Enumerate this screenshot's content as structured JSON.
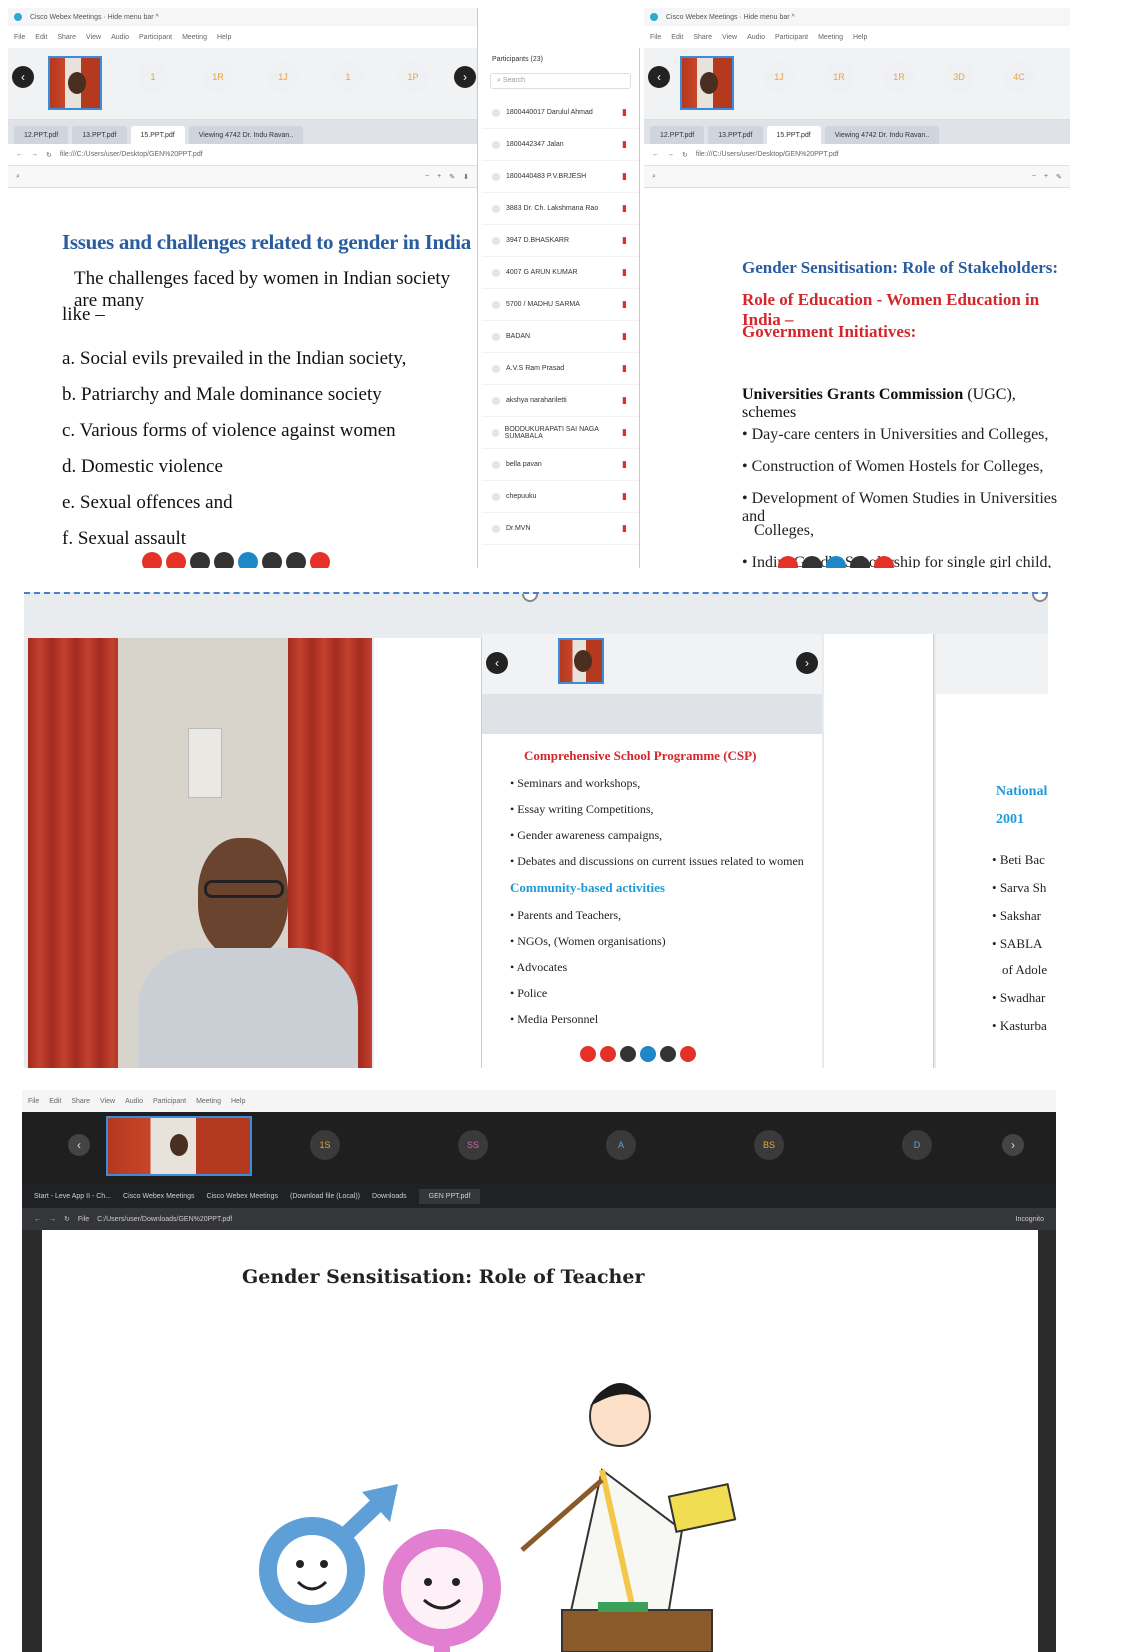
{
  "panelA": {
    "left_window": {
      "title": "Cisco Webex Meetings · Hide menu bar ^",
      "menu": [
        "File",
        "Edit",
        "Share",
        "View",
        "Audio",
        "Participant",
        "Meeting",
        "Help"
      ],
      "tiles": [
        "1",
        "1R",
        "1J",
        "1",
        "1P"
      ],
      "tabs": [
        "12.PPT.pdf",
        "13.PPT.pdf",
        "15.PPT.pdf",
        "Viewing 4742 Dr. Indu Ravan.."
      ],
      "url": "file:///C:/Users/user/Desktop/GEN%20PPT.pdf",
      "slide": {
        "title": "Issues and challenges related to gender in India",
        "intro": "The challenges faced by women in Indian society are many",
        "intro2": "like –",
        "items": [
          "a. Social evils prevailed in the Indian society,",
          "b. Patriarchy and Male dominance society",
          "c. Various forms of violence against women",
          "d. Domestic violence",
          "e. Sexual offences and",
          "f. Sexual assault"
        ]
      }
    },
    "participants": {
      "header": "Participants (23)",
      "search": "Search",
      "rows": [
        "1800440017 Darulul Ahmad",
        "1800442347 Jalan",
        "1800440483 P.V.BRJESH",
        "3883 Dr. Ch. Lakshmana Rao",
        "3947 D.BHASKARR",
        "4007 G ARUN KUMAR",
        "5700 / MADHU SARMA",
        "BADAN",
        "A.V.S Ram Prasad",
        "akshya narahariletti",
        "BODDUKURAPATI SAI NAGA SUMABALA",
        "bella pavan",
        "chepuuku",
        "Dr.MVN"
      ]
    },
    "right_window": {
      "title": "Cisco Webex Meetings · Hide menu bar ^",
      "tiles": [
        "1J",
        "1R",
        "1R",
        "3D",
        "4C"
      ],
      "tabs": [
        "12.PPT.pdf",
        "13.PPT.pdf",
        "15.PPT.pdf",
        "Viewing 4742 Dr. Indu Ravan.."
      ],
      "url": "file:///C:/Users/user/Desktop/GEN%20PPT.pdf",
      "slide": {
        "heading1": "Gender Sensitisation:  Role of Stakeholders:",
        "heading2": "Role of Education - Women Education in India –",
        "heading3": "Government Initiatives:",
        "ugc_bold": "Universities Grants Commission",
        "ugc_rest": " (UGC), schemes",
        "bullets": [
          "Day-care centers in Universities and Colleges,",
          "Construction of Women Hostels for Colleges,",
          "Development of Women Studies in Universities and",
          "Colleges,",
          "Indira Gandhi Scholarship for single girl child, and"
        ]
      }
    }
  },
  "panelB": {
    "slide": {
      "heading": "Comprehensive School Programme (CSP)",
      "bullets1": [
        "Seminars and workshops,",
        "Essay writing Competitions,",
        "Gender awareness campaigns,",
        "Debates and discussions on current issues related to women"
      ],
      "heading2": "Community-based activities",
      "bullets2": [
        "Parents and Teachers,",
        "NGOs, (Women organisations)",
        "Advocates",
        "Police",
        "Media Personnel"
      ]
    },
    "right_slide": {
      "heading": "National I",
      "year": "2001",
      "bullets": [
        "Beti Bac",
        "Sarva Sh",
        "Sakshar",
        "SABLA",
        "of Adole",
        "Swadhar",
        "Kasturba"
      ]
    }
  },
  "panelC": {
    "menu": [
      "File",
      "Edit",
      "Share",
      "View",
      "Audio",
      "Participant",
      "Meeting",
      "Help"
    ],
    "tiles": [
      "1S",
      "SS",
      "A",
      "BS",
      "D"
    ],
    "taskbar": [
      "Start - Leve App II - Ch...",
      "Cisco Webex Meetings",
      "Cisco Webex Meetings",
      "(Download file (Local))",
      "Downloads",
      "GEN PPT.pdf"
    ],
    "url": "C:/Users/user/Downloads/GEN%20PPT.pdf",
    "address_label": "File",
    "incognito": "Incognito",
    "slide_title": "Gender Sensitisation: Role of Teacher"
  }
}
